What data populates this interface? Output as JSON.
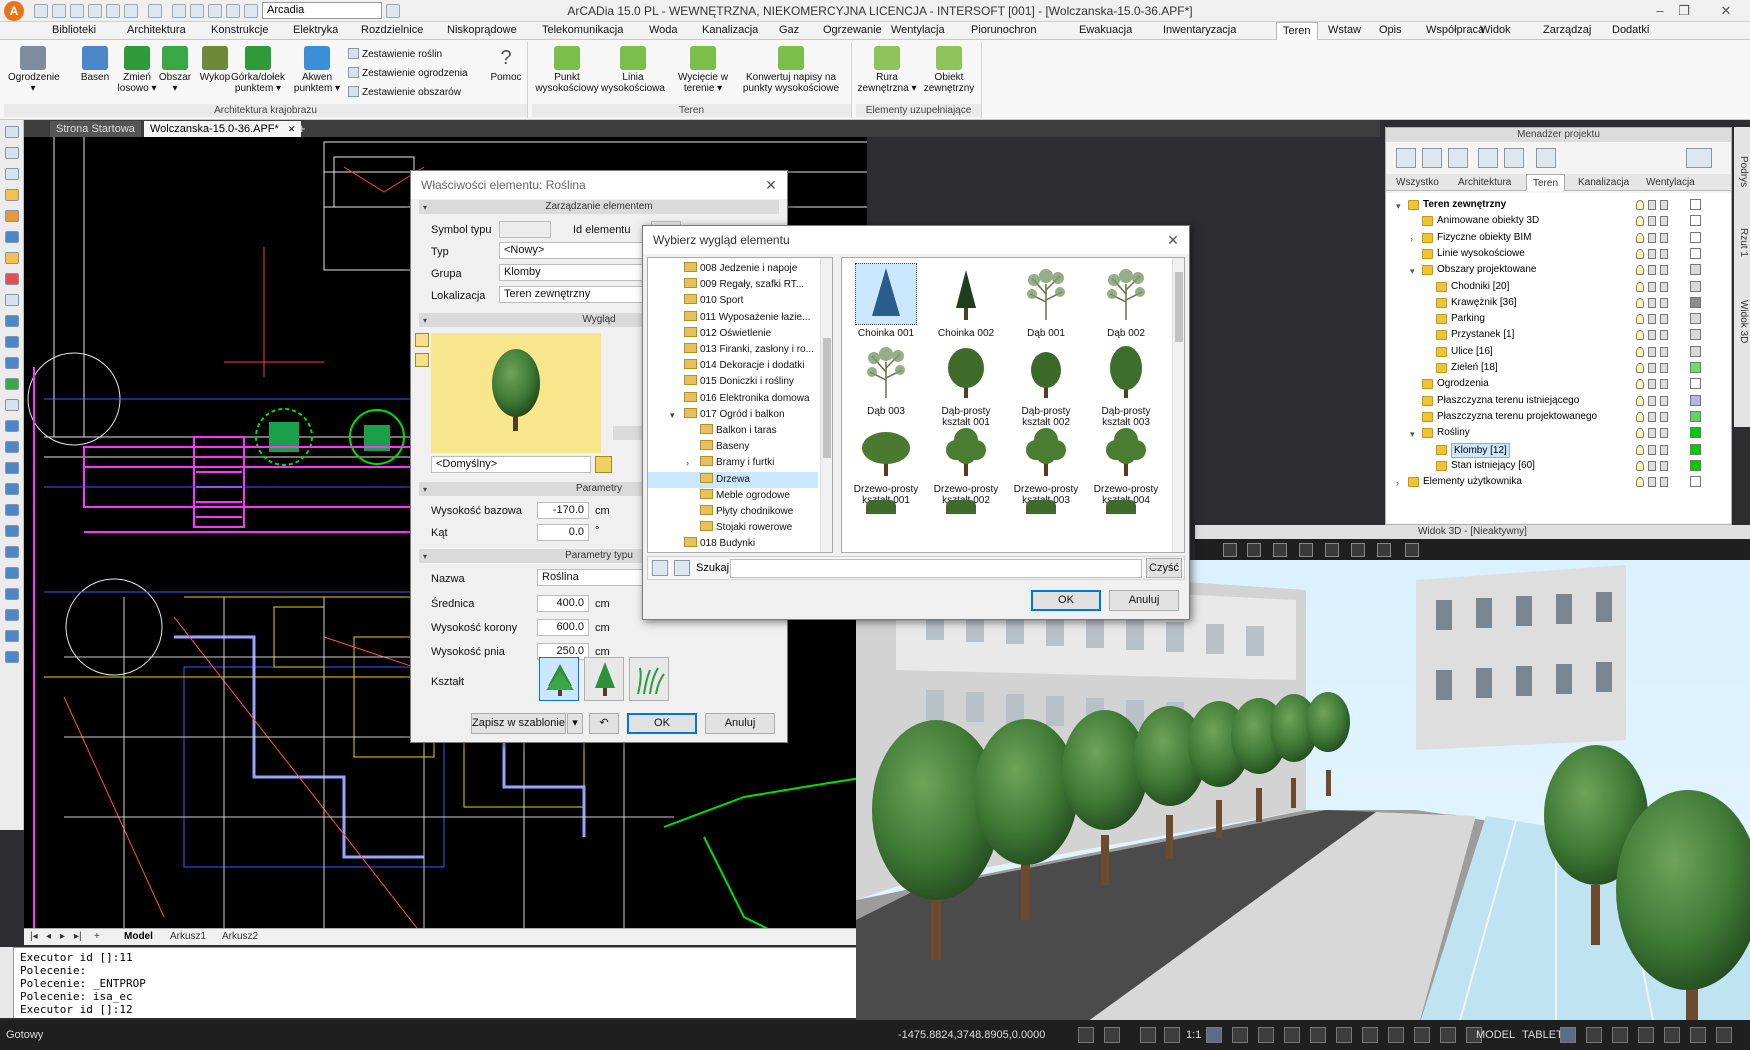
{
  "window": {
    "title": "ArCADia 15.0 PL - WEWNĘTRZNA, NIEKOMERCYJNA LICENCJA - INTERSOFT [001] - [Wolczanska-15.0-36.APF*]",
    "profile_combo": "Arcadia",
    "minimize": "–",
    "restore": "❐",
    "close": "✕"
  },
  "menu": [
    "Biblioteki",
    "Architektura",
    "Konstrukcje",
    "Elektryka",
    "Rozdzielnice",
    "Niskoprądowe",
    "Telekomunikacja",
    "Woda",
    "Kanalizacja",
    "Gaz",
    "Ogrzewanie",
    "Wentylacja",
    "Piorunochron",
    "Ewakuacja",
    "Inwentaryzacja",
    "Teren",
    "Wstaw",
    "Opis",
    "Współpraca",
    "Widok",
    "Zarządzaj",
    "Dodatki"
  ],
  "menu_active": "Teren",
  "ribbon": {
    "group1": {
      "label": "Architektura krajobrazu",
      "buttons": [
        {
          "label": "Ogrodzenie",
          "sub": "▾"
        },
        {
          "label": "Basen",
          "sub": ""
        },
        {
          "label": "Zmień",
          "sub": "losowo ▾"
        },
        {
          "label": "Obszar",
          "sub": "▾"
        },
        {
          "label": "Wykop",
          "sub": ""
        },
        {
          "label": "Górka/dołek",
          "sub": "punktem ▾"
        },
        {
          "label": "Akwen",
          "sub": "punktem ▾"
        }
      ],
      "small": [
        "Zestawienie roślin",
        "Zestawienie ogrodzenia",
        "Zestawienie obszarów"
      ],
      "help": "Pomoc",
      "help_glyph": "?"
    },
    "group2": {
      "label": "Teren",
      "buttons": [
        {
          "label": "Punkt",
          "sub": "wysokościowy"
        },
        {
          "label": "Linia",
          "sub": "wysokościowa"
        },
        {
          "label": "Wycięcie w",
          "sub": "terenie ▾"
        },
        {
          "label": "Konwertuj napisy na",
          "sub": "punkty wysokościowe"
        }
      ]
    },
    "group3": {
      "label": "Elementy uzupełniające",
      "buttons": [
        {
          "label": "Rura",
          "sub": "zewnętrzna ▾"
        },
        {
          "label": "Obiekt",
          "sub": "zewnętrzny"
        }
      ]
    }
  },
  "doc_tabs": {
    "start": "Strona Startowa",
    "file": "Wolczanska-15.0-36.APF*",
    "close": "✕",
    "add": "+"
  },
  "project_manager": {
    "title": "Menadżer projektu",
    "tabs": [
      "Wszystko",
      "Architektura",
      "Teren",
      "Kanalizacja",
      "Wentylacja"
    ],
    "active_tab": "Teren",
    "tree": [
      {
        "label": "Teren zewnętrzny",
        "level": 0,
        "toggle": "▾",
        "bold": true,
        "swatch": "#ffffff"
      },
      {
        "label": "Animowane obiekty 3D",
        "level": 1,
        "toggle": "",
        "swatch": "#ffffff"
      },
      {
        "label": "Fizyczne obiekty BIM",
        "level": 1,
        "toggle": "›",
        "swatch": "#ffffff"
      },
      {
        "label": "Linie wysokościowe",
        "level": 1,
        "toggle": "",
        "swatch": "#ffffff"
      },
      {
        "label": "Obszary projektowane",
        "level": 1,
        "toggle": "▾",
        "swatch": "#d9d9d9"
      },
      {
        "label": "Chodniki [20]",
        "level": 2,
        "toggle": "",
        "swatch": "#d9d9d9"
      },
      {
        "label": "Krawężnik [36]",
        "level": 2,
        "toggle": "",
        "swatch": "#8c8c8c"
      },
      {
        "label": "Parking",
        "level": 2,
        "toggle": "",
        "swatch": "#d9d9d9"
      },
      {
        "label": "Przystanek [1]",
        "level": 2,
        "toggle": "",
        "swatch": "#d9d9d9"
      },
      {
        "label": "Ulice [16]",
        "level": 2,
        "toggle": "",
        "swatch": "#d9d9d9"
      },
      {
        "label": "Zieleń [18]",
        "level": 2,
        "toggle": "",
        "swatch": "#66e066"
      },
      {
        "label": "Ogrodzenia",
        "level": 1,
        "toggle": "",
        "swatch": "#ffffff"
      },
      {
        "label": "Płaszczyzna terenu istniejącego",
        "level": 1,
        "toggle": "",
        "swatch": "#b4b4f0"
      },
      {
        "label": "Płaszczyzna terenu projektowanego",
        "level": 1,
        "toggle": "",
        "swatch": "#5cd65c"
      },
      {
        "label": "Rośliny",
        "level": 1,
        "toggle": "▾",
        "swatch": "#00cc00"
      },
      {
        "label": "Klomby [12]",
        "level": 2,
        "toggle": "",
        "swatch": "#00cc00",
        "selected": true
      },
      {
        "label": "Stan istniejący [60]",
        "level": 2,
        "toggle": "",
        "swatch": "#00cc00"
      },
      {
        "label": "Elementy użytkownika",
        "level": 0,
        "toggle": "›",
        "swatch": "#ffffff"
      }
    ]
  },
  "side_tabs": [
    "Podrys",
    "Rzut 1",
    "Widok 3D"
  ],
  "view3d": {
    "title": "Widok 3D - [Nieaktywny]"
  },
  "model_tabs": [
    "Model",
    "Arkusz1",
    "Arkusz2"
  ],
  "model_tabs_active": "Model",
  "command_lines": [
    "Executor id []:11",
    "Polecenie:",
    "Polecenie: _ENTPROP",
    "Polecenie: isa_ec",
    "Executor id []:12"
  ],
  "status": {
    "ready": "Gotowy",
    "coords": "-1475.8824,3748.8905,0.0000",
    "scale": "1:1",
    "model": "MODEL",
    "tablet": "TABLET"
  },
  "props_dialog": {
    "title": "Właściwości elementu: Roślina",
    "close": "✕",
    "section_manage": "Zarządzanie elementem",
    "symbol_label": "Symbol typu",
    "symbol_value": "",
    "id_label": "Id elementu",
    "id_value": "",
    "type_label": "Typ",
    "type_value": "<Nowy>",
    "group_label": "Grupa",
    "group_value": "Klomby",
    "location_label": "Lokalizacja",
    "location_value": "Teren zewnętrzny",
    "section_look": "Wygląd",
    "look_combo": "<Domyślny>",
    "section_params": "Parametry",
    "base_height_label": "Wysokość bazowa",
    "base_height_value": "-170.0",
    "base_height_unit": "cm",
    "angle_label": "Kąt",
    "angle_value": "0.0",
    "angle_unit": "°",
    "section_type_params": "Parametry typu",
    "name_label": "Nazwa",
    "name_value": "Roślina",
    "diameter_label": "Średnica",
    "diameter_value": "400.0",
    "diameter_unit": "cm",
    "crown_label": "Wysokość korony",
    "crown_value": "600.0",
    "crown_unit": "cm",
    "trunk_label": "Wysokość pnia",
    "trunk_value": "250.0",
    "trunk_unit": "cm",
    "shape_label": "Kształt",
    "save_template": "Zapisz w szablonie",
    "ok": "OK",
    "cancel": "Anuluj"
  },
  "select_dialog": {
    "title": "Wybierz wygląd elementu",
    "close": "✕",
    "folders": [
      {
        "label": "008 Jedzenie i napoje",
        "indent": 0,
        "toggle": ""
      },
      {
        "label": "009 Regały, szafki RT...",
        "indent": 0,
        "toggle": ""
      },
      {
        "label": "010 Sport",
        "indent": 0,
        "toggle": ""
      },
      {
        "label": "011 Wyposażenie łazie...",
        "indent": 0,
        "toggle": ""
      },
      {
        "label": "012 Oświetlenie",
        "indent": 0,
        "toggle": ""
      },
      {
        "label": "013 Firanki, zasłony i ro...",
        "indent": 0,
        "toggle": ""
      },
      {
        "label": "014 Dekoracje i dodatki",
        "indent": 0,
        "toggle": ""
      },
      {
        "label": "015 Doniczki i rośliny",
        "indent": 0,
        "toggle": ""
      },
      {
        "label": "016 Elektronika domowa",
        "indent": 0,
        "toggle": ""
      },
      {
        "label": "017 Ogród i balkon",
        "indent": 0,
        "toggle": "▾"
      },
      {
        "label": "Balkon i taras",
        "indent": 1,
        "toggle": ""
      },
      {
        "label": "Baseny",
        "indent": 1,
        "toggle": ""
      },
      {
        "label": "Bramy i furtki",
        "indent": 1,
        "toggle": "›"
      },
      {
        "label": "Drzewa",
        "indent": 1,
        "toggle": "",
        "selected": true
      },
      {
        "label": "Meble ogrodowe",
        "indent": 1,
        "toggle": ""
      },
      {
        "label": "Płyty chodnikowe",
        "indent": 1,
        "toggle": ""
      },
      {
        "label": "Stojaki rowerowe",
        "indent": 1,
        "toggle": ""
      },
      {
        "label": "018 Budynki",
        "indent": 0,
        "toggle": ""
      }
    ],
    "thumbs": [
      {
        "label": "Choinka 001",
        "kind": "spruce",
        "selected": true
      },
      {
        "label": "Choinka 002",
        "kind": "pine"
      },
      {
        "label": "Dąb 001",
        "kind": "bare"
      },
      {
        "label": "Dąb 002",
        "kind": "bare2"
      },
      {
        "label": "Dąb 003",
        "kind": "bare3"
      },
      {
        "label": "Dąb-prosty kształt 001",
        "kind": "round"
      },
      {
        "label": "Dąb-prosty kształt 002",
        "kind": "round2"
      },
      {
        "label": "Dąb-prosty kształt 003",
        "kind": "round3"
      },
      {
        "label": "Drzewo-prosty kształt 001",
        "kind": "wide"
      },
      {
        "label": "Drzewo-prosty kształt 002",
        "kind": "leafy"
      },
      {
        "label": "Drzewo-prosty kształt 003",
        "kind": "leafy2"
      },
      {
        "label": "Drzewo-prosty kształt 004",
        "kind": "leafy3"
      }
    ],
    "search_label": "Szukaj:",
    "search_value": "",
    "clear": "Czyść",
    "ok": "OK",
    "cancel": "Anuluj"
  },
  "colors": {
    "accent": "#0078d7",
    "plant_green": "#2e6b2e",
    "drawing_bg": "#000000"
  }
}
